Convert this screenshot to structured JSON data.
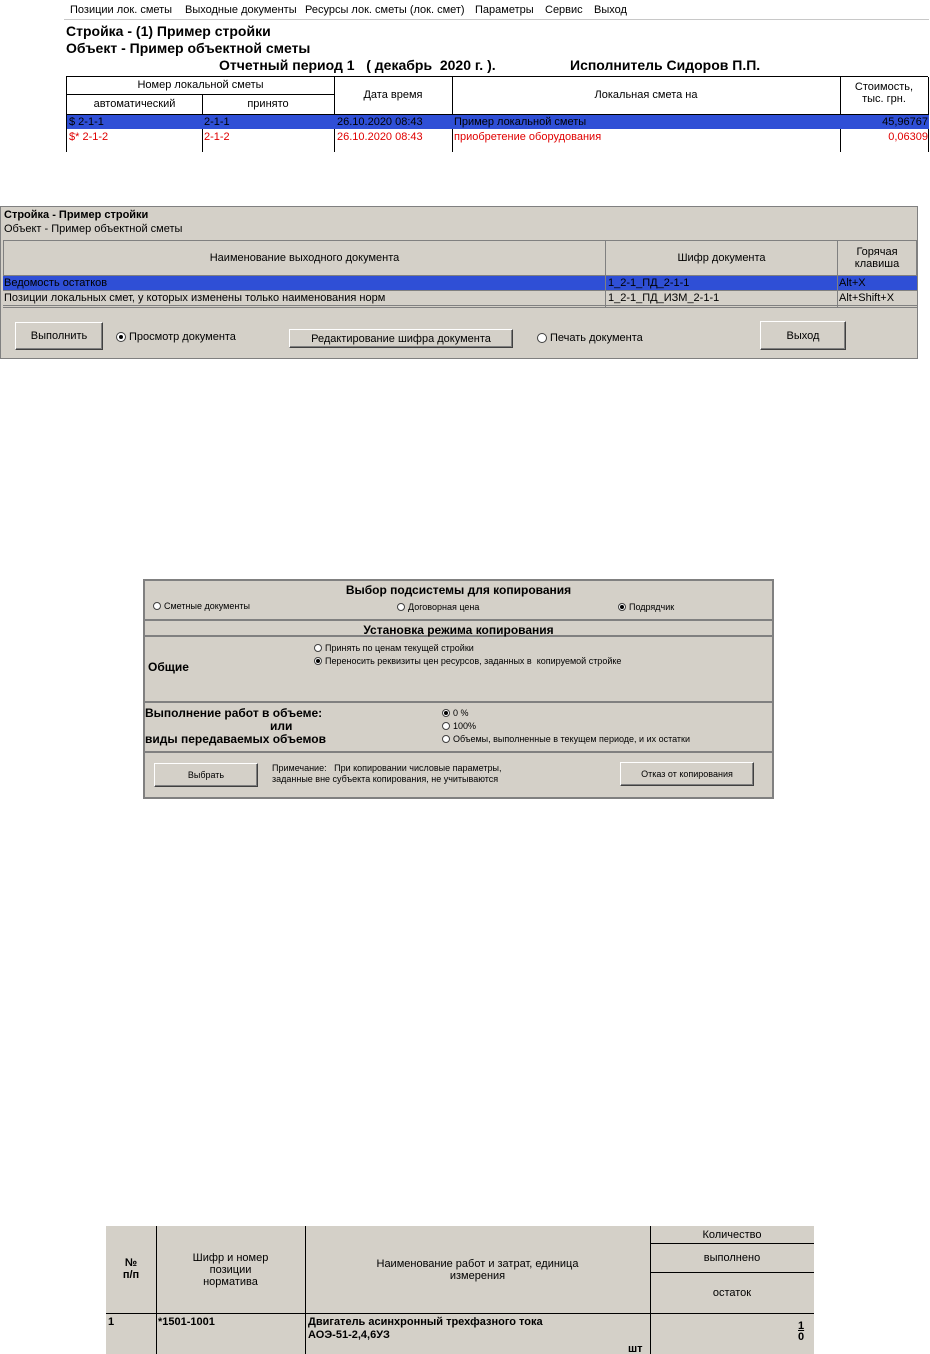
{
  "panel1": {
    "menu": [
      "Позиции лок. сметы",
      "Выходные документы",
      "Ресурсы лок. сметы (лок. смет)",
      "Параметры",
      "Сервис",
      "Выход"
    ],
    "line1": "Стройка - (1) Пример стройки",
    "line2": "Объект - Пример объектной сметы",
    "period": "Отчетный период 1   ( декабрь  2020 г. ).",
    "executor": "Исполнитель Сидоров П.П.",
    "headers": {
      "local_number": "Номер локальной сметы",
      "auto": "автоматический",
      "accepted": "принято",
      "datetime": "Дата время",
      "local_estimate": "Локальная смета на",
      "cost_line1": "Стоимость,",
      "cost_line2": "тыс. грн."
    },
    "rows": [
      {
        "auto": "$ 2-1-1",
        "accepted": "2-1-1",
        "datetime": "26.10.2020 08:43",
        "name": "Пример локальной сметы",
        "cost": "45,96767"
      },
      {
        "auto": "$* 2-1-2",
        "accepted": "2-1-2",
        "datetime": "26.10.2020 08:43",
        "name": "приобретение оборудования",
        "cost": "0,06309"
      }
    ]
  },
  "panel2": {
    "line1": "Стройка - Пример стройки",
    "line2": "Объект - Пример объектной сметы",
    "headers": {
      "doc_name": "Наименование выходного документа",
      "doc_code": "Шифр документа",
      "hotkey_line1": "Горячая",
      "hotkey_line2": "клавиша"
    },
    "rows": [
      {
        "name": "Ведомость остатков",
        "code": "1_2-1_ПД_2-1-1",
        "hotkey": "Alt+X"
      },
      {
        "name": "Позиции локальных смет, у которых изменены только наименования норм",
        "code": "1_2-1_ПД_ИЗМ_2-1-1",
        "hotkey": "Alt+Shift+X"
      }
    ],
    "execute_button": "Выполнить",
    "view_radio": "Просмотр документа",
    "edit_code_button": "Редактирование шифра документа",
    "print_radio": "Печать документа",
    "exit_button": "Выход"
  },
  "panel3": {
    "title1": "Выбор подсистемы для копирования",
    "opt_estimate": "Сметные документы",
    "opt_contract": "Договорная цена",
    "opt_contractor": "Подрядчик",
    "title2": "Установка режима копирования",
    "general_label": "Общие",
    "opt_current_prices": "Принять по ценам текущей стройки",
    "opt_transfer": "Переносить реквизиты цен ресурсов, заданных в  копируемой стройке",
    "volume_label1": "Выполнение работ в объеме:",
    "volume_label2": "или",
    "volume_label3": "виды передаваемых объемов",
    "opt_0": "0 %",
    "opt_100": "100%",
    "opt_volumes": "Объемы, выполненные в текущем периоде, и их остатки",
    "select_button": "Выбрать",
    "note_line1": "Примечание:   При копировании числовые параметры,",
    "note_line2": "заданные вне субъекта копирования, не учитываются",
    "cancel_button": "Отказ от копирования"
  },
  "panel4": {
    "h_num1": "№",
    "h_num2": "п/п",
    "h_code1": "Шифр и номер",
    "h_code2": "позиции",
    "h_code3": "норматива",
    "h_name1": "Наименование работ и затрат, единица",
    "h_name2": "измерения",
    "h_qty": "Количество",
    "h_done": "выполнено",
    "h_rest": "остаток",
    "row_num": "1",
    "row_code": "*1501-1001",
    "row_name1": "Двигатель асинхронный трехфазного тока",
    "row_name2": "АОЭ-51-2,4,6УЗ",
    "row_unit": "шт",
    "row_done": "1",
    "row_rest": "0"
  }
}
